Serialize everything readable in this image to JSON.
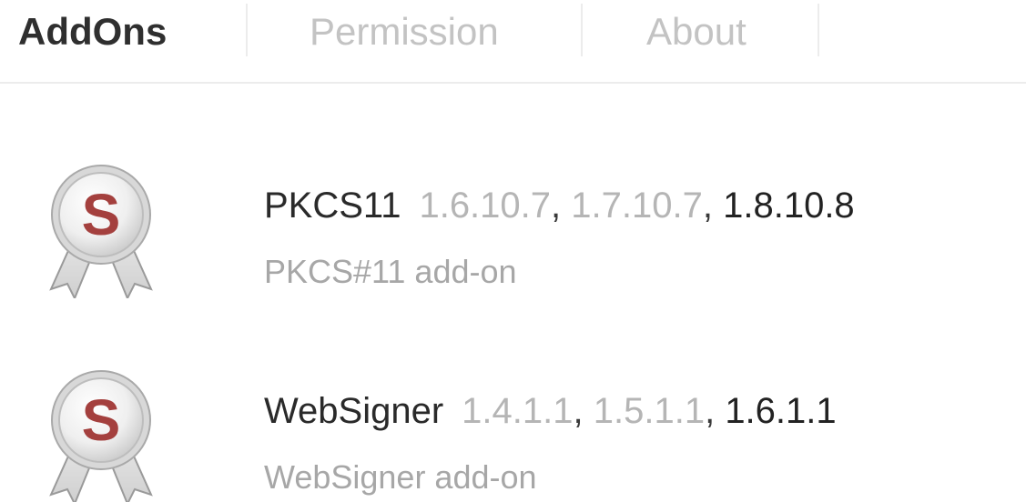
{
  "tabs": [
    {
      "label": "AddOns",
      "active": true
    },
    {
      "label": "Permission",
      "active": false
    },
    {
      "label": "About",
      "active": false
    }
  ],
  "addons": [
    {
      "name": "PKCS11",
      "versions": [
        "1.6.10.7",
        "1.7.10.7",
        "1.8.10.8"
      ],
      "separator": ",",
      "description": "PKCS#11 add-on",
      "icon": "award-ribbon-badge-icon",
      "icon_letter": "S"
    },
    {
      "name": "WebSigner",
      "versions": [
        "1.4.1.1",
        "1.5.1.1",
        "1.6.1.1"
      ],
      "separator": ",",
      "description": "WebSigner add-on",
      "icon": "award-ribbon-badge-icon",
      "icon_letter": "S"
    }
  ],
  "colors": {
    "active_tab": "#2f2f2f",
    "inactive_tab": "#c3c3c3",
    "old_version": "#b5b5b5",
    "current_version": "#222222",
    "description": "#a7a7a7",
    "badge_letter": "#a4403e"
  }
}
